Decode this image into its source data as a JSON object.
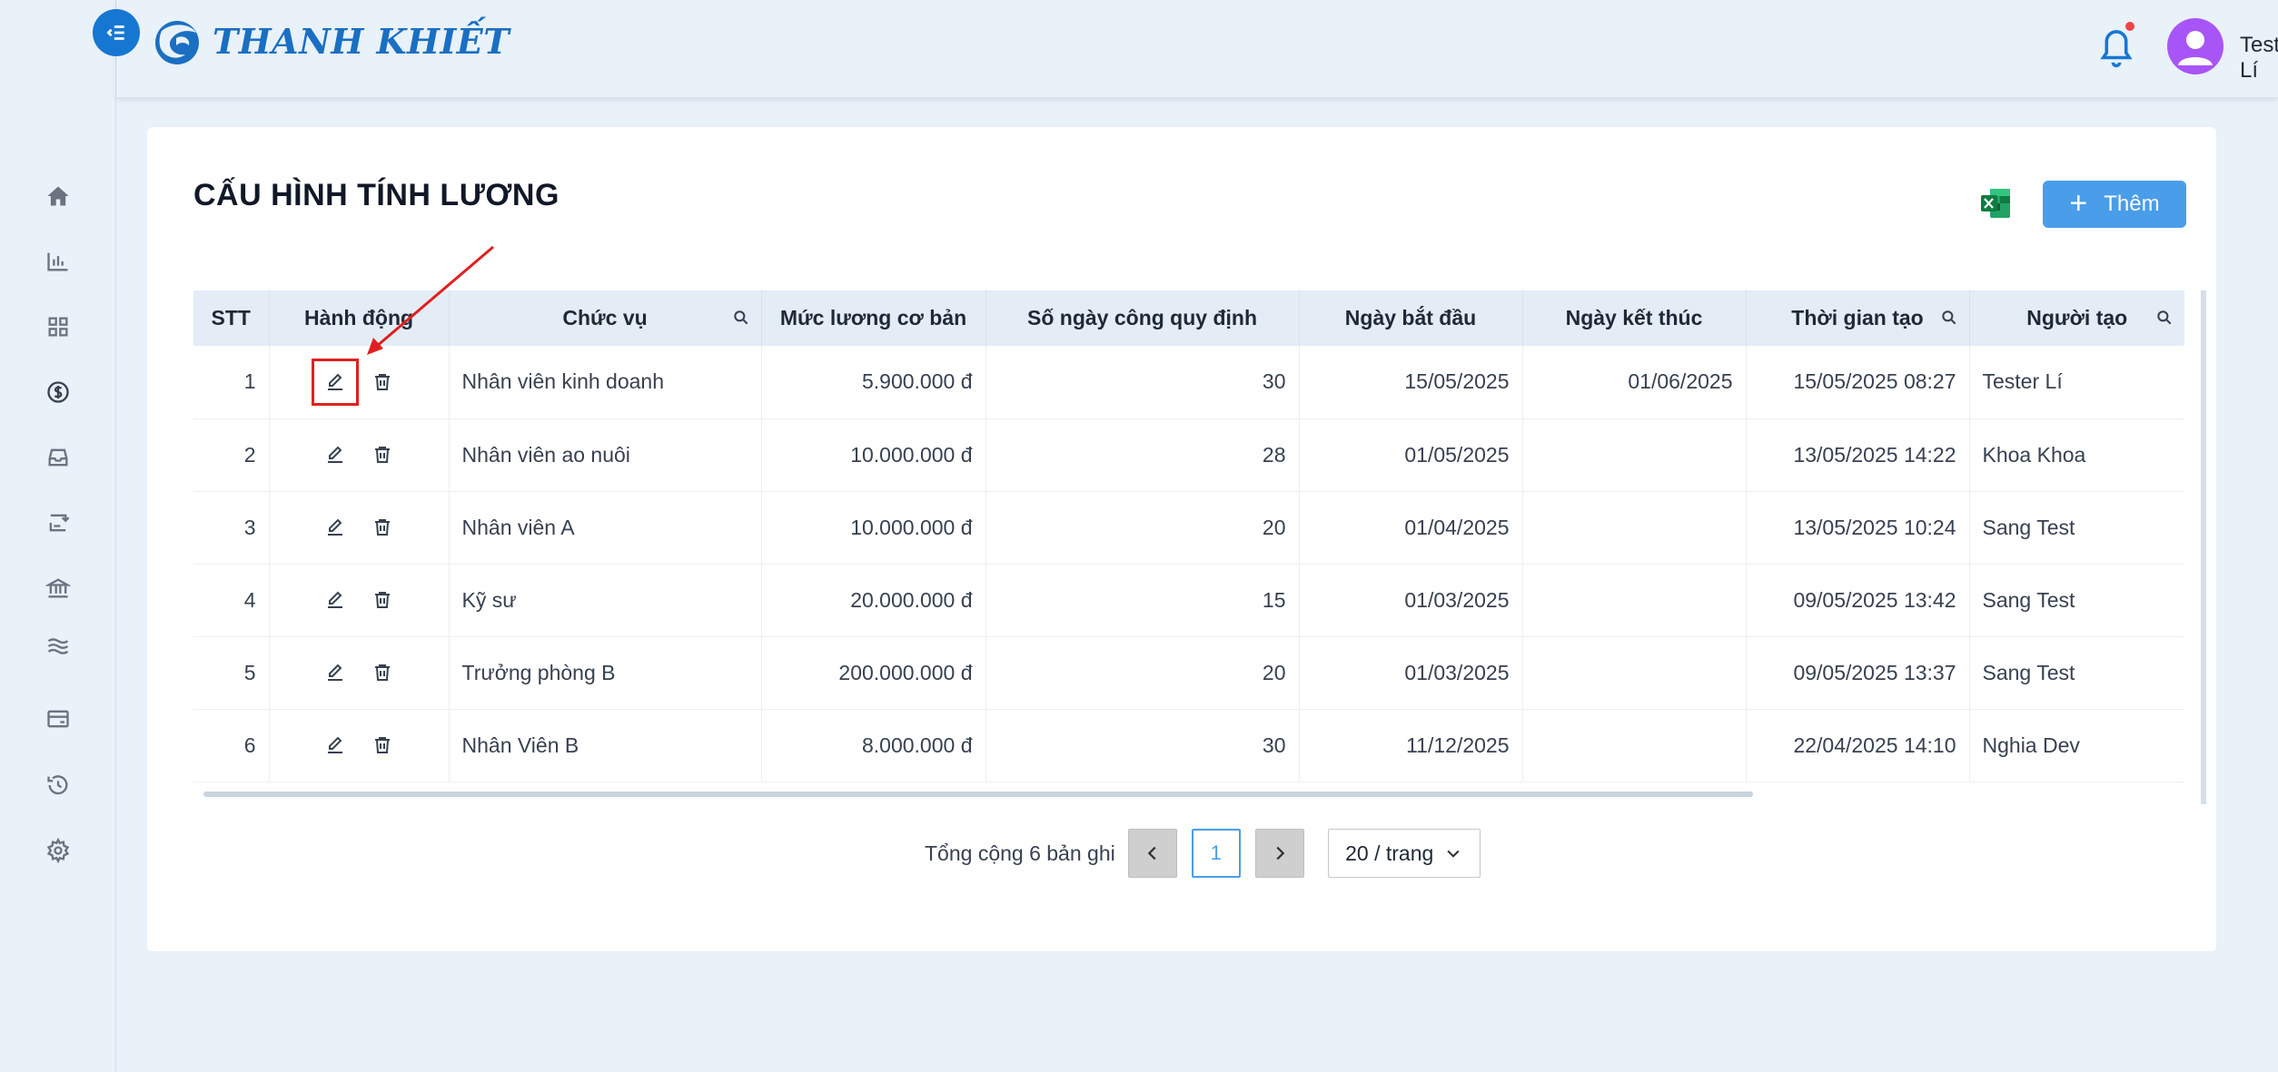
{
  "app": {
    "brand": "THANH KHIẾT"
  },
  "header": {
    "user_name": "Tester Lí"
  },
  "sidebar": {
    "items": [
      {
        "icon": "home-icon"
      },
      {
        "icon": "bar-chart-icon"
      },
      {
        "icon": "grid-icon"
      },
      {
        "icon": "dollar-icon"
      },
      {
        "icon": "inbox-icon"
      },
      {
        "icon": "transfer-icon"
      },
      {
        "icon": "bank-icon"
      },
      {
        "icon": "waves-icon"
      },
      {
        "icon": "card-icon"
      },
      {
        "icon": "history-icon"
      },
      {
        "icon": "settings-icon"
      }
    ]
  },
  "page": {
    "title": "CẤU HÌNH TÍNH LƯƠNG",
    "add_label": "Thêm"
  },
  "table": {
    "columns": [
      "STT",
      "Hành động",
      "Chức vụ",
      "Mức lương cơ bản",
      "Số ngày công quy định",
      "Ngày bắt đầu",
      "Ngày kết thúc",
      "Thời gian tạo",
      "Người tạo"
    ],
    "rows": [
      {
        "stt": "1",
        "position": "Nhân viên kinh doanh",
        "salary": "5.900.000 đ",
        "days": "30",
        "start": "15/05/2025",
        "end": "01/06/2025",
        "created": "15/05/2025 08:27",
        "creator": "Tester Lí"
      },
      {
        "stt": "2",
        "position": "Nhân viên ao nuôi",
        "salary": "10.000.000 đ",
        "days": "28",
        "start": "01/05/2025",
        "end": "",
        "created": "13/05/2025 14:22",
        "creator": "Khoa Khoa"
      },
      {
        "stt": "3",
        "position": "Nhân viên A",
        "salary": "10.000.000 đ",
        "days": "20",
        "start": "01/04/2025",
        "end": "",
        "created": "13/05/2025 10:24",
        "creator": "Sang Test"
      },
      {
        "stt": "4",
        "position": "Kỹ sư",
        "salary": "20.000.000 đ",
        "days": "15",
        "start": "01/03/2025",
        "end": "",
        "created": "09/05/2025 13:42",
        "creator": "Sang Test"
      },
      {
        "stt": "5",
        "position": "Trưởng phòng B",
        "salary": "200.000.000 đ",
        "days": "20",
        "start": "01/03/2025",
        "end": "",
        "created": "09/05/2025 13:37",
        "creator": "Sang Test"
      },
      {
        "stt": "6",
        "position": "Nhân Viên B",
        "salary": "8.000.000 đ",
        "days": "30",
        "start": "11/12/2025",
        "end": "",
        "created": "22/04/2025 14:10",
        "creator": "Nghia Dev"
      }
    ]
  },
  "pagination": {
    "total_text": "Tổng cộng 6 bản ghi",
    "current_page": "1",
    "page_size": "20 / trang"
  },
  "colors": {
    "primary": "#1677d2",
    "button": "#4a9de8",
    "brand_text": "#1a6fc2",
    "highlight": "#e02020",
    "avatar": "#a855f7"
  }
}
